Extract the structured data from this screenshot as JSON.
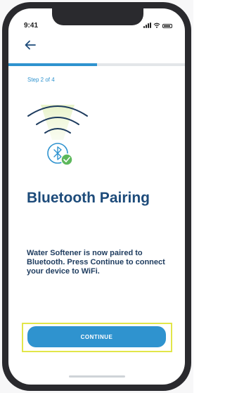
{
  "status_bar": {
    "time": "9:41"
  },
  "navigation": {
    "back_icon": "arrow-left-icon"
  },
  "progress": {
    "current_step": 2,
    "total_steps": 4,
    "fraction": 0.5,
    "label": "Step 2 of 4"
  },
  "illustration": {
    "icons": [
      "wifi-waves-icon",
      "bluetooth-icon",
      "check-badge-icon"
    ]
  },
  "content": {
    "title": "Bluetooth Pairing",
    "description": "Water Softener is now paired to Bluetooth. Press Continue to connect your device to WiFi."
  },
  "actions": {
    "continue_label": "CONTINUE"
  },
  "colors": {
    "accent": "#2f93cf",
    "title": "#1d4b7a",
    "success": "#5db85c",
    "highlight": "#e2e64a"
  }
}
